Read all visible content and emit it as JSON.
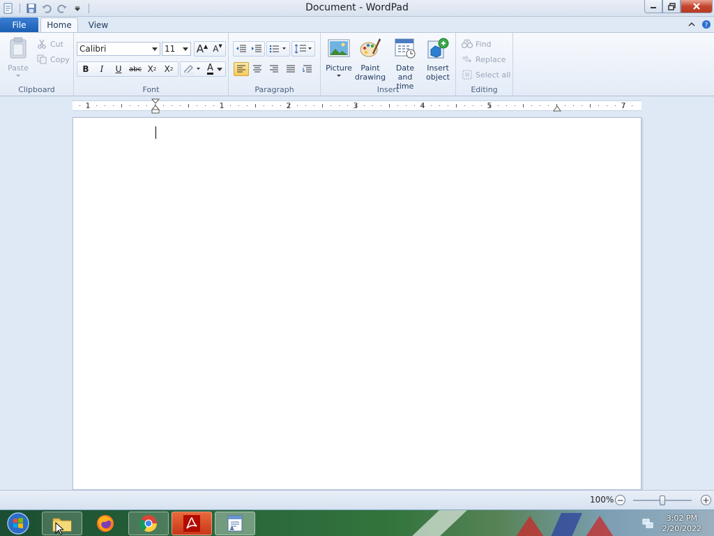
{
  "window": {
    "title": "Document - WordPad"
  },
  "tabs": {
    "file": "File",
    "home": "Home",
    "view": "View"
  },
  "clipboard": {
    "label": "Clipboard",
    "paste": "Paste",
    "cut": "Cut",
    "copy": "Copy"
  },
  "font": {
    "label": "Font",
    "family": "Calibri",
    "size": "11",
    "grow": "A",
    "shrink": "A",
    "bold": "B",
    "italic": "I",
    "underline": "U",
    "strikethrough": "abc",
    "subscript": "X",
    "superscript": "X",
    "color_glyph": "A"
  },
  "paragraph": {
    "label": "Paragraph"
  },
  "insert": {
    "label": "Insert",
    "picture": "Picture",
    "paint_line1": "Paint",
    "paint_line2": "drawing",
    "datetime_line1": "Date and",
    "datetime_line2": "time",
    "object_line1": "Insert",
    "object_line2": "object"
  },
  "editing": {
    "label": "Editing",
    "find": "Find",
    "replace": "Replace",
    "select_all": "Select all"
  },
  "ruler": {
    "numbers": [
      "1",
      "1",
      "2",
      "3",
      "4",
      "5",
      "7"
    ]
  },
  "status": {
    "zoom": "100%",
    "zoom_out": "−",
    "zoom_in": "+"
  },
  "clock": {
    "time": "3:02 PM",
    "date": "2/20/2022"
  },
  "colors": {
    "accent": "#1a5fb4",
    "ribbon_bg": "#f7f9fd",
    "active_button": "#f7c95a"
  }
}
